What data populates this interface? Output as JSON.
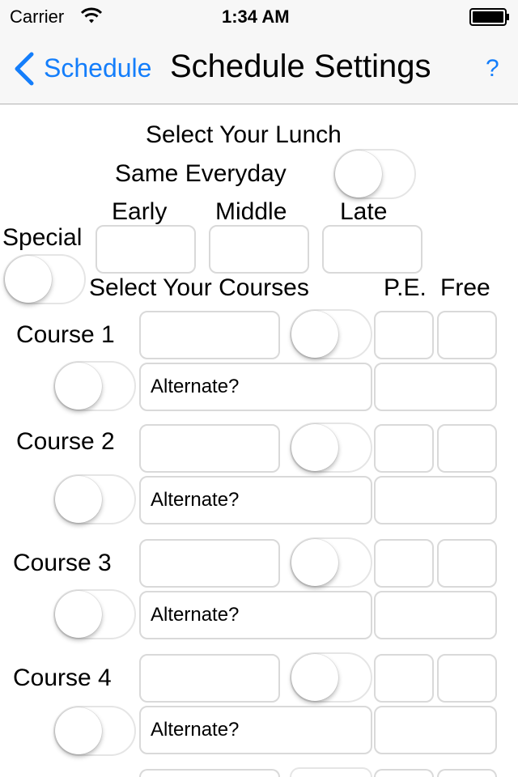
{
  "status_bar": {
    "carrier": "Carrier",
    "time": "1:34 AM"
  },
  "nav": {
    "back_label": "Schedule",
    "title": "Schedule Settings",
    "help_label": "?"
  },
  "lunch": {
    "heading": "Select Your Lunch",
    "same_everyday_label": "Same Everyday",
    "same_everyday_on": false,
    "columns": [
      "Early",
      "Middle",
      "Late"
    ],
    "special_label": "Special",
    "special_on": false
  },
  "courses": {
    "heading": "Select Your Courses",
    "pe_label": "P.E.",
    "free_label": "Free",
    "items": [
      {
        "label": "Course 1",
        "name_value": "",
        "toggle_on": false,
        "alt_toggle_on": false,
        "alternate_placeholder": "Alternate?"
      },
      {
        "label": "Course 2",
        "name_value": "",
        "toggle_on": false,
        "alt_toggle_on": false,
        "alternate_placeholder": "Alternate?"
      },
      {
        "label": "Course 3",
        "name_value": "",
        "toggle_on": false,
        "alt_toggle_on": false,
        "alternate_placeholder": "Alternate?"
      },
      {
        "label": "Course 4",
        "name_value": "",
        "toggle_on": false,
        "alt_toggle_on": false,
        "alternate_placeholder": "Alternate?"
      }
    ]
  },
  "colors": {
    "accent": "#147efb",
    "bar_background": "#f7f7f7",
    "border": "#d9d9d9"
  }
}
